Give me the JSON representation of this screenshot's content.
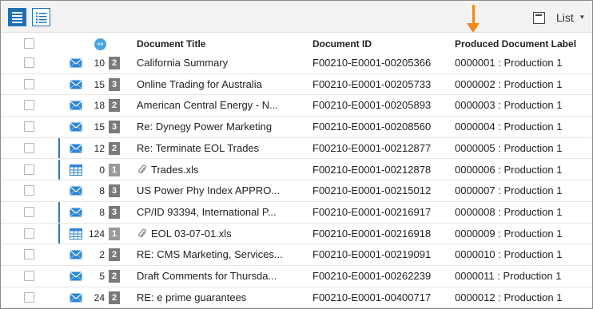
{
  "toolbar": {
    "list_label": "List",
    "list_caret": "▾",
    "arrow_color": "#f08a1c",
    "accent_color": "#1f6fb5"
  },
  "header": {
    "thread_icon": "thread-icon",
    "thread_text": "«»",
    "document_title": "Document Title",
    "document_id": "Document ID",
    "produced_label": "Produced Document Label"
  },
  "rows": [
    {
      "icon": "email-icon",
      "count": "10",
      "badge": "2",
      "title": "California Summary",
      "doc_id": "F00210-E0001-00205366",
      "label": "0000001 : Production 1",
      "grouped": false
    },
    {
      "icon": "email-icon",
      "count": "15",
      "badge": "3",
      "title": "Online Trading for Australia",
      "doc_id": "F00210-E0001-00205733",
      "label": "0000002 : Production 1",
      "grouped": false
    },
    {
      "icon": "email-icon",
      "count": "18",
      "badge": "2",
      "title": "American Central Energy - N...",
      "doc_id": "F00210-E0001-00205893",
      "label": "0000003 : Production 1",
      "grouped": false
    },
    {
      "icon": "email-icon",
      "count": "15",
      "badge": "3",
      "title": "Re: Dynegy Power Marketing",
      "doc_id": "F00210-E0001-00208560",
      "label": "0000004 : Production 1",
      "grouped": false
    },
    {
      "icon": "email-icon",
      "count": "12",
      "badge": "2",
      "title": "Re: Terminate EOL Trades",
      "doc_id": "F00210-E0001-00212877",
      "label": "0000005 : Production 1",
      "grouped": true
    },
    {
      "icon": "spreadsheet-icon",
      "count": "0",
      "badge": "1",
      "title": "Trades.xls",
      "doc_id": "F00210-E0001-00212878",
      "label": "0000006 : Production 1",
      "grouped": true,
      "attachment": true
    },
    {
      "icon": "email-icon",
      "count": "8",
      "badge": "3",
      "title": "US Power Phy Index APPRO...",
      "doc_id": "F00210-E0001-00215012",
      "label": "0000007 : Production 1",
      "grouped": false
    },
    {
      "icon": "email-icon",
      "count": "8",
      "badge": "3",
      "title": "CP/ID 93394, International P...",
      "doc_id": "F00210-E0001-00216917",
      "label": "0000008 : Production 1",
      "grouped": true
    },
    {
      "icon": "spreadsheet-icon",
      "count": "124",
      "badge": "1",
      "title": "EOL 03-07-01.xls",
      "doc_id": "F00210-E0001-00216918",
      "label": "0000009 : Production 1",
      "grouped": true,
      "attachment": true
    },
    {
      "icon": "email-icon",
      "count": "2",
      "badge": "2",
      "title": "RE: CMS Marketing, Services...",
      "doc_id": "F00210-E0001-00219091",
      "label": "0000010 : Production 1",
      "grouped": false
    },
    {
      "icon": "email-icon",
      "count": "5",
      "badge": "2",
      "title": "Draft Comments for Thursda...",
      "doc_id": "F00210-E0001-00262239",
      "label": "0000011 : Production 1",
      "grouped": false
    },
    {
      "icon": "email-icon",
      "count": "24",
      "badge": "2",
      "title": "RE: e prime guarantees",
      "doc_id": "F00210-E0001-00400717",
      "label": "0000012 : Production 1",
      "grouped": false
    }
  ]
}
